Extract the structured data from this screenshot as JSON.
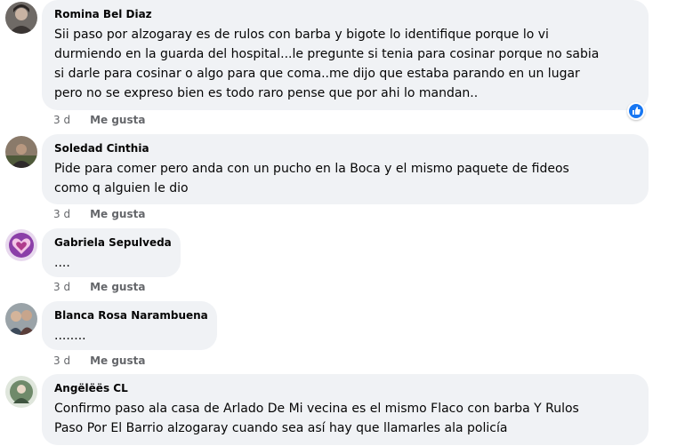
{
  "comments": [
    {
      "author": "Romina Bel Diaz",
      "text": "Sii paso por alzogaray es de rulos con barba y bigote lo identifique porque lo vi\ndurmiendo en la guarda del hospital...le pregunte si tenia para cosinar porque no sabia\nsi darle para cosinar o algo para que coma..me dijo que estaba parando en un lugar\npero no se expreso bien es todo raro pense que por ahi lo mandan..",
      "time": "3 d",
      "like_label": "Me gusta",
      "reaction": "like-reaction-icon"
    },
    {
      "author": "Soledad Cinthia",
      "text": "Pide para comer pero anda con un pucho en la Boca y el mismo paquete de fideos\ncomo q alguien le dio",
      "time": "3 d",
      "like_label": "Me gusta"
    },
    {
      "author": "Gabriela Sepulveda",
      "text": "....",
      "time": "3 d",
      "like_label": "Me gusta"
    },
    {
      "author": "Blanca Rosa Narambuena",
      "text": "........",
      "time": "3 d",
      "like_label": "Me gusta"
    },
    {
      "author": "Angëlëës CL",
      "text": "Confirmo paso ala casa de Arlado De Mi vecina es el mismo Flaco con barba Y Rulos\nPaso Por El Barrio alzogaray cuando sea así hay que llamarles ala policía",
      "time": "",
      "like_label": ""
    }
  ],
  "colors": {
    "bubble": "#f0f2f5",
    "meta_text": "#65676b",
    "like_blue": "#1877f2"
  }
}
